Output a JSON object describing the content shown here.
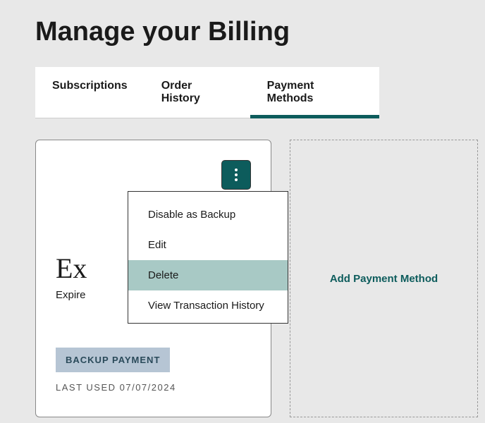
{
  "pageTitle": "Manage your Billing",
  "tabs": [
    {
      "label": "Subscriptions"
    },
    {
      "label": "Order History"
    },
    {
      "label": "Payment Methods"
    }
  ],
  "card": {
    "titleVisible": "Ex",
    "subtextVisible": "Expire",
    "badge": "BACKUP PAYMENT",
    "lastUsed": "LAST USED 07/07/2024"
  },
  "dropdown": {
    "items": [
      {
        "label": "Disable as Backup"
      },
      {
        "label": "Edit"
      },
      {
        "label": "Delete"
      },
      {
        "label": "View Transaction History"
      }
    ]
  },
  "addCard": {
    "label": "Add Payment Method"
  }
}
